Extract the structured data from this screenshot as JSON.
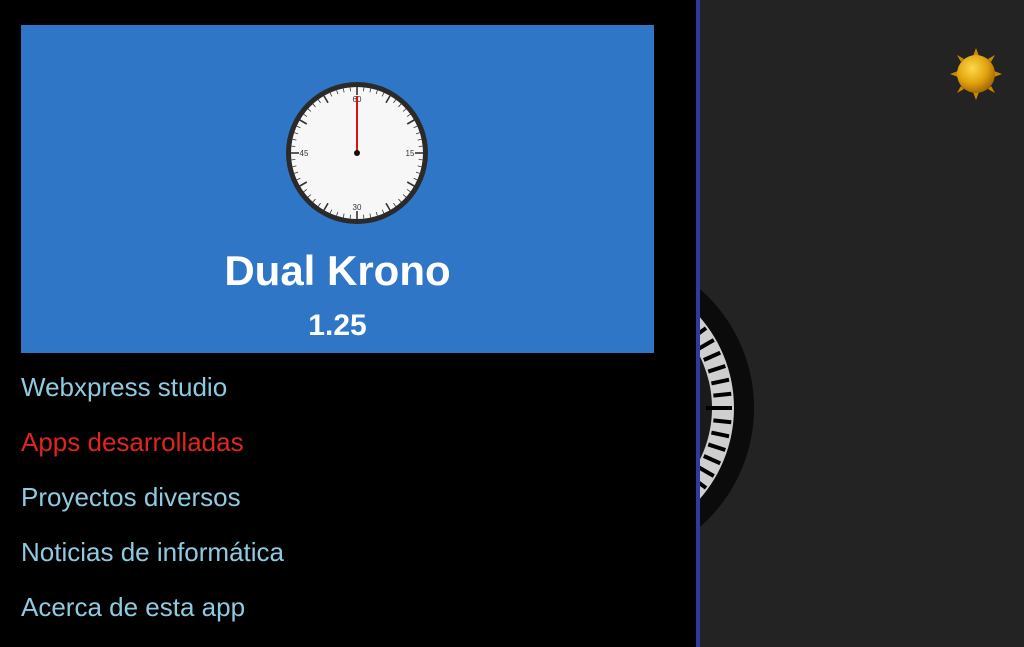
{
  "header": {
    "app_name": "Dual Krono",
    "version": "1.25",
    "clock_marks": [
      "60",
      "15",
      "30",
      "45"
    ]
  },
  "menu": {
    "items": [
      {
        "label": "Webxpress studio",
        "active": false
      },
      {
        "label": "Apps desarrolladas",
        "active": true
      },
      {
        "label": "Proyectos diversos",
        "active": false
      },
      {
        "label": "Noticias de informática",
        "active": false
      },
      {
        "label": "Acerca de esta app",
        "active": false
      }
    ]
  },
  "colors": {
    "header_bg": "#3076c7",
    "menu_text": "#8fcbe0",
    "menu_active": "#e0251f",
    "drawer_border": "#2e3a9e",
    "app_bg": "#232323"
  },
  "icons": {
    "theme_toggle": "sun-icon",
    "header_logo": "stopwatch-clock-icon"
  }
}
